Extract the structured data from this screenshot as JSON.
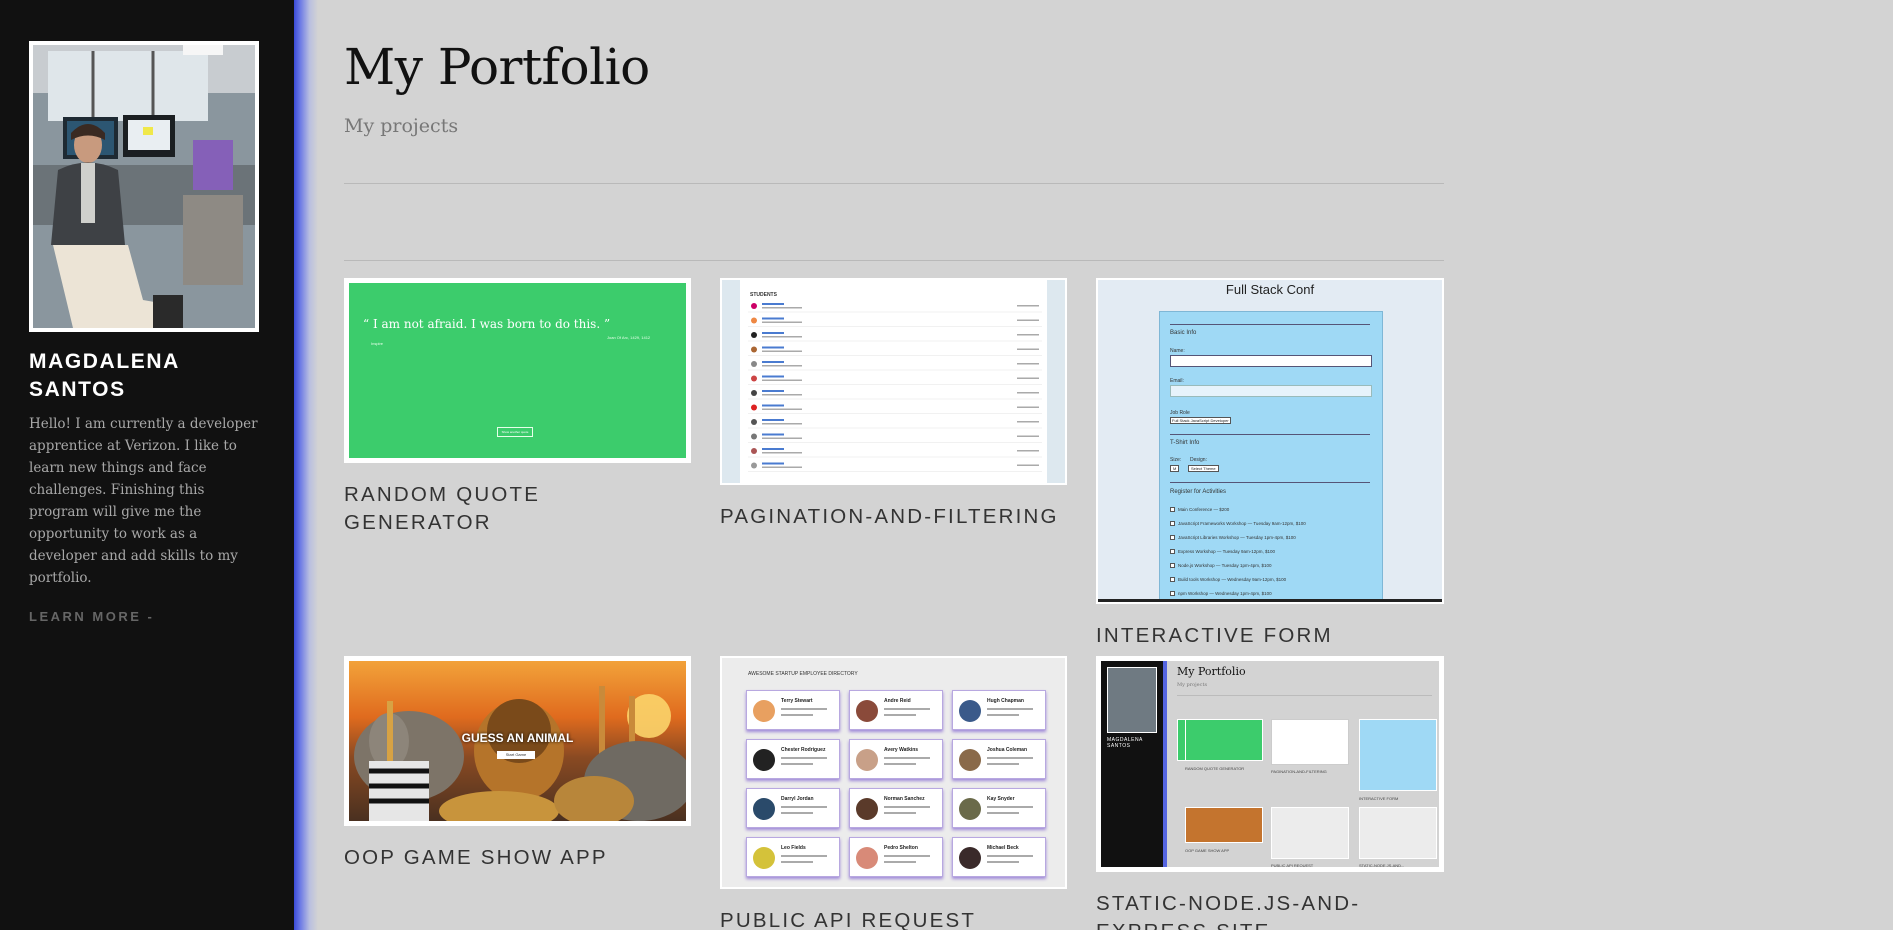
{
  "sidebar": {
    "name": "MAGDALENA SANTOS",
    "bio": "Hello! I am currently a developer apprentice at Verizon. I like to learn new things and face challenges. Finishing this program will give me the opportunity to work as a developer and add skills to my portfolio.",
    "learn_more": "LEARN MORE -"
  },
  "main": {
    "title": "My Portfolio",
    "subtitle": "My projects"
  },
  "projects": [
    {
      "label": "RANDOM QUOTE GENERATOR",
      "preview": {
        "quote": "“ I am not afraid. I was born to do this. ”",
        "author": "Joan Of Arc, 1429, 1412",
        "tag": "Inspire",
        "button": "Show another quote"
      }
    },
    {
      "label": "PAGINATION-AND-FILTERING",
      "preview": {
        "heading": "STUDENTS"
      }
    },
    {
      "label": "INTERACTIVE FORM",
      "preview": {
        "title": "Full Stack Conf",
        "section_basic": "Basic Info",
        "name_label": "Name:",
        "email_label": "Email:",
        "job_label": "Job Role",
        "job_value": "Full Stack JavaScript Developer",
        "section_shirt": "T-Shirt Info",
        "size_label": "Size:",
        "design_label": "Design:",
        "size_value": "M",
        "design_value": "Select Theme",
        "section_activities": "Register for Activities",
        "activities": [
          "Main Conference — $200",
          "JavaScript Frameworks Workshop — Tuesday 9am-12pm, $100",
          "JavaScript Libraries Workshop — Tuesday 1pm-4pm, $100",
          "Express Workshop — Tuesday 9am-12pm, $100",
          "Node.js Workshop — Tuesday 1pm-4pm, $100",
          "Build tools Workshop — Wednesday 9am-12pm, $100",
          "npm Workshop — Wednesday 1pm-4pm, $100"
        ]
      }
    },
    {
      "label": "OOP GAME SHOW APP",
      "preview": {
        "title": "GUESS AN ANIMAL",
        "button": "Start Game"
      }
    },
    {
      "label": "PUBLIC API REQUEST",
      "preview": {
        "heading": "AWESOME STARTUP EMPLOYEE DIRECTORY",
        "employees": [
          "Terry Stewart",
          "Andre Reid",
          "Hugh Chapman",
          "Chester Rodriguez",
          "Avery Watkins",
          "Joshua Coleman",
          "Darryl Jordan",
          "Norman Sanchez",
          "Kay Snyder",
          "Leo Fields",
          "Pedro Shelton",
          "Michael Beck"
        ]
      }
    },
    {
      "label": "STATIC-NODE.JS-AND-EXPRESS SITE",
      "preview": {
        "title": "My Portfolio",
        "subtitle": "My projects",
        "name": "MAGDALENA SANTOS",
        "labels": [
          "RANDOM QUOTE GENERATOR",
          "PAGINATION-AND-FILTERING",
          "INTERACTIVE FORM",
          "OOP GAME SHOW APP",
          "PUBLIC API REQUEST",
          "STATIC-NODE.JS-AND..."
        ]
      }
    }
  ],
  "colors": {
    "sidebar_bg": "#111111",
    "page_bg": "#d3d3d3",
    "sidebar_accent": "#3a4bd8",
    "quote_green": "#3ccc6c",
    "form_blue": "#9fd9f5"
  }
}
